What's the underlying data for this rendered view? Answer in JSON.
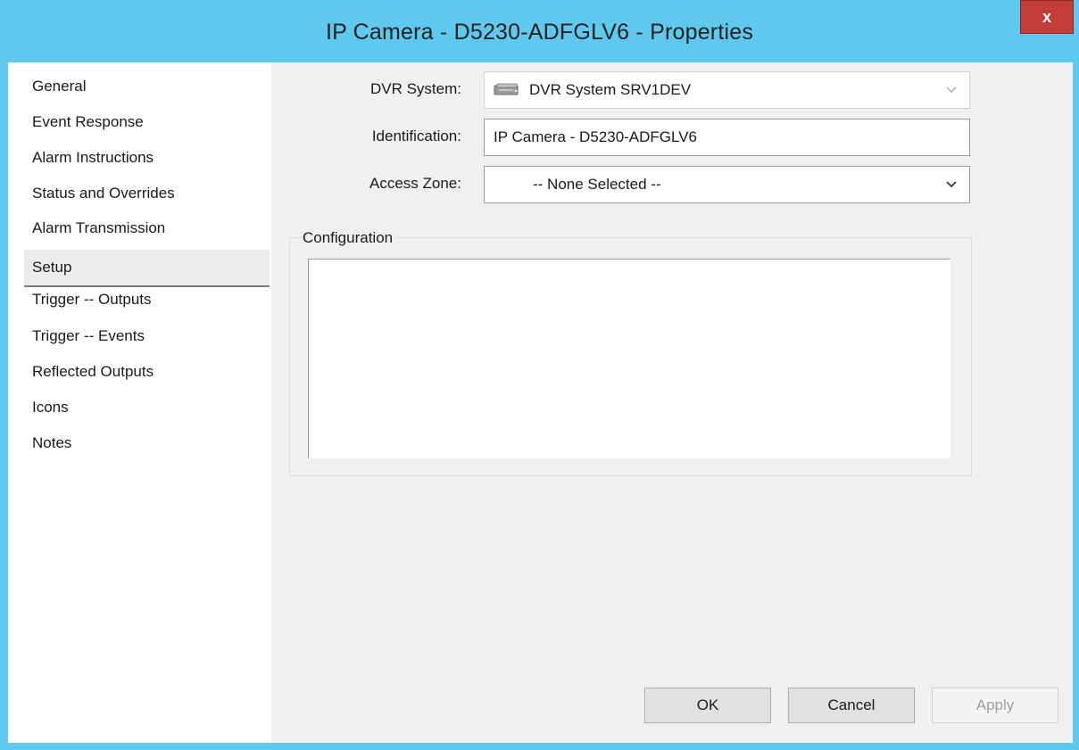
{
  "window": {
    "title": "IP Camera - D5230-ADFGLV6 - Properties",
    "close_label": "x"
  },
  "nav": {
    "items": [
      {
        "label": "General"
      },
      {
        "label": "Event Response"
      },
      {
        "label": "Alarm Instructions"
      },
      {
        "label": "Status and Overrides"
      },
      {
        "label": "Alarm Transmission"
      },
      {
        "label": "Setup",
        "selected": true
      },
      {
        "label": "Trigger -- Outputs"
      },
      {
        "label": "Trigger -- Events"
      },
      {
        "label": "Reflected Outputs"
      },
      {
        "label": "Icons"
      },
      {
        "label": "Notes"
      }
    ]
  },
  "form": {
    "dvr_label": "DVR System:",
    "dvr_value": "DVR System SRV1DEV",
    "dvr_icon": "dvr-system-icon",
    "identification_label": "Identification:",
    "identification_value": "IP Camera - D5230-ADFGLV6",
    "access_zone_label": "Access Zone:",
    "access_zone_value": "-- None Selected --",
    "configuration_label": "Configuration"
  },
  "buttons": {
    "ok": "OK",
    "cancel": "Cancel",
    "apply": "Apply"
  },
  "colors": {
    "titlebar": "#5ec8ef",
    "close": "#c43c3c"
  }
}
